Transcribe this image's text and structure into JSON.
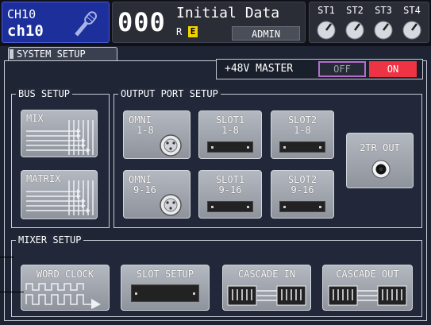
{
  "header": {
    "channel_number": "CH10",
    "channel_name": "ch10",
    "channel_icon": "microphone-icon",
    "scene_number": "000",
    "scene_title": "Initial Data",
    "scene_read_only": "R",
    "scene_edit": "E",
    "user": "ADMIN",
    "stereo_labels": [
      "ST1",
      "ST2",
      "ST3",
      "ST4"
    ]
  },
  "tab": {
    "label": "SYSTEM SETUP"
  },
  "phantom": {
    "label": "+48V MASTER",
    "off_label": "OFF",
    "on_label": "ON",
    "state": "ON"
  },
  "bus_setup": {
    "title": "BUS SETUP",
    "mix_label": "MIX",
    "matrix_label": "MATRIX"
  },
  "output_port_setup": {
    "title": "OUTPUT PORT SETUP",
    "omni_1_8": {
      "line1": "OMNI",
      "line2": "1-8"
    },
    "slot1_1_8": {
      "line1": "SLOT1",
      "line2": "1-8"
    },
    "slot2_1_8": {
      "line1": "SLOT2",
      "line2": "1-8"
    },
    "omni_9_16": {
      "line1": "OMNI",
      "line2": "9-16"
    },
    "slot1_9_16": {
      "line1": "SLOT1",
      "line2": "9-16"
    },
    "slot2_9_16": {
      "line1": "SLOT2",
      "line2": "9-16"
    },
    "two_tr_out": "2TR OUT"
  },
  "mixer_setup": {
    "title": "MIXER SETUP",
    "word_clock": "WORD CLOCK",
    "slot_setup": "SLOT SETUP",
    "cascade_in": "CASCADE IN",
    "cascade_out": "CASCADE OUT"
  },
  "colors": {
    "channel_blue": "#1d2f9a",
    "on_red": "#ee3444",
    "off_purple": "#b070c8",
    "edit_yellow": "#f3d400"
  }
}
